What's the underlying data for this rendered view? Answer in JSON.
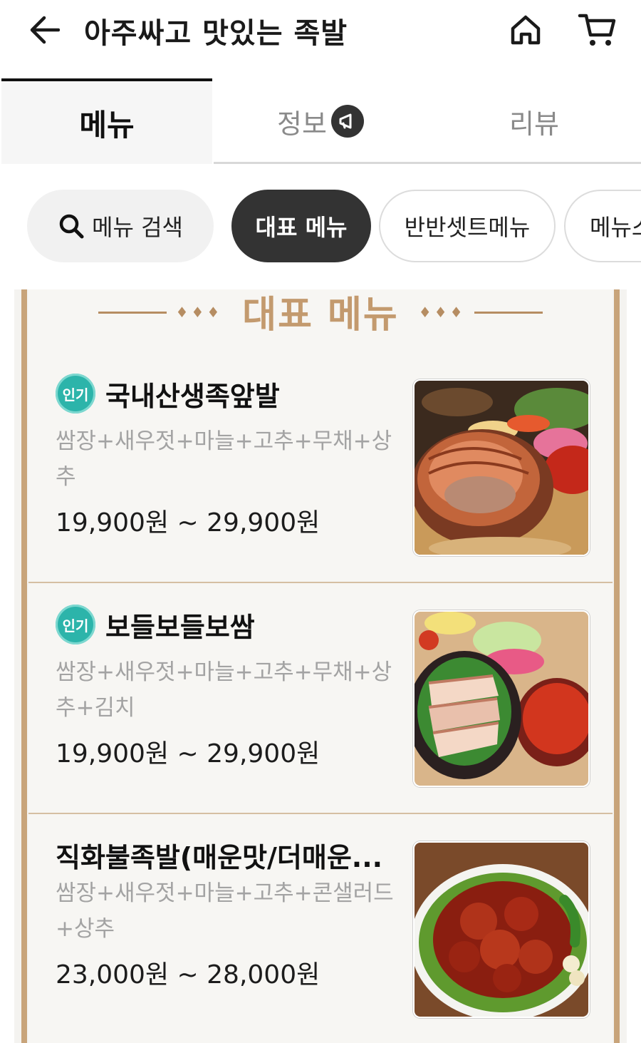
{
  "header": {
    "title": "아주싸고 맛있는 족발",
    "back_icon": "arrow-left-icon",
    "home_icon": "home-icon",
    "cart_icon": "cart-icon"
  },
  "tabs": [
    {
      "label": "메뉴",
      "active": true
    },
    {
      "label": "정보",
      "icon": "megaphone-icon"
    },
    {
      "label": "리뷰"
    }
  ],
  "chips": {
    "search_label": "메뉴 검색",
    "items": [
      "대표 메뉴",
      "반반셋트메뉴",
      "메뉴스"
    ],
    "active_index": 0
  },
  "section": {
    "title": "대표 메뉴",
    "decoration": "♦♦♦"
  },
  "menu_items": [
    {
      "name": "국내산생족앞발",
      "badge": "인기",
      "description": "쌈장+새우젓+마늘+고추+무채+상추",
      "price": "19,900원 ~ 29,900원",
      "photo": "jokbal-platter"
    },
    {
      "name": "보들보들보쌈",
      "badge": "인기",
      "description": "쌈장+새우젓+마늘+고추+무채+상추+김치",
      "price": "19,900원 ~ 29,900원",
      "photo": "bossam-platter"
    },
    {
      "name": "직화불족발(매운맛/더매운...",
      "badge": "",
      "description": "쌈장+새우젓+마늘+고추+콘샐러드+상추",
      "price": "23,000원 ~ 28,000원",
      "photo": "spicy-jokbal-platter"
    }
  ],
  "colors": {
    "accent_gold": "#c39a6e",
    "board_border": "#c8a47a",
    "badge_teal": "#2cb4aa",
    "chip_active": "#333333"
  }
}
